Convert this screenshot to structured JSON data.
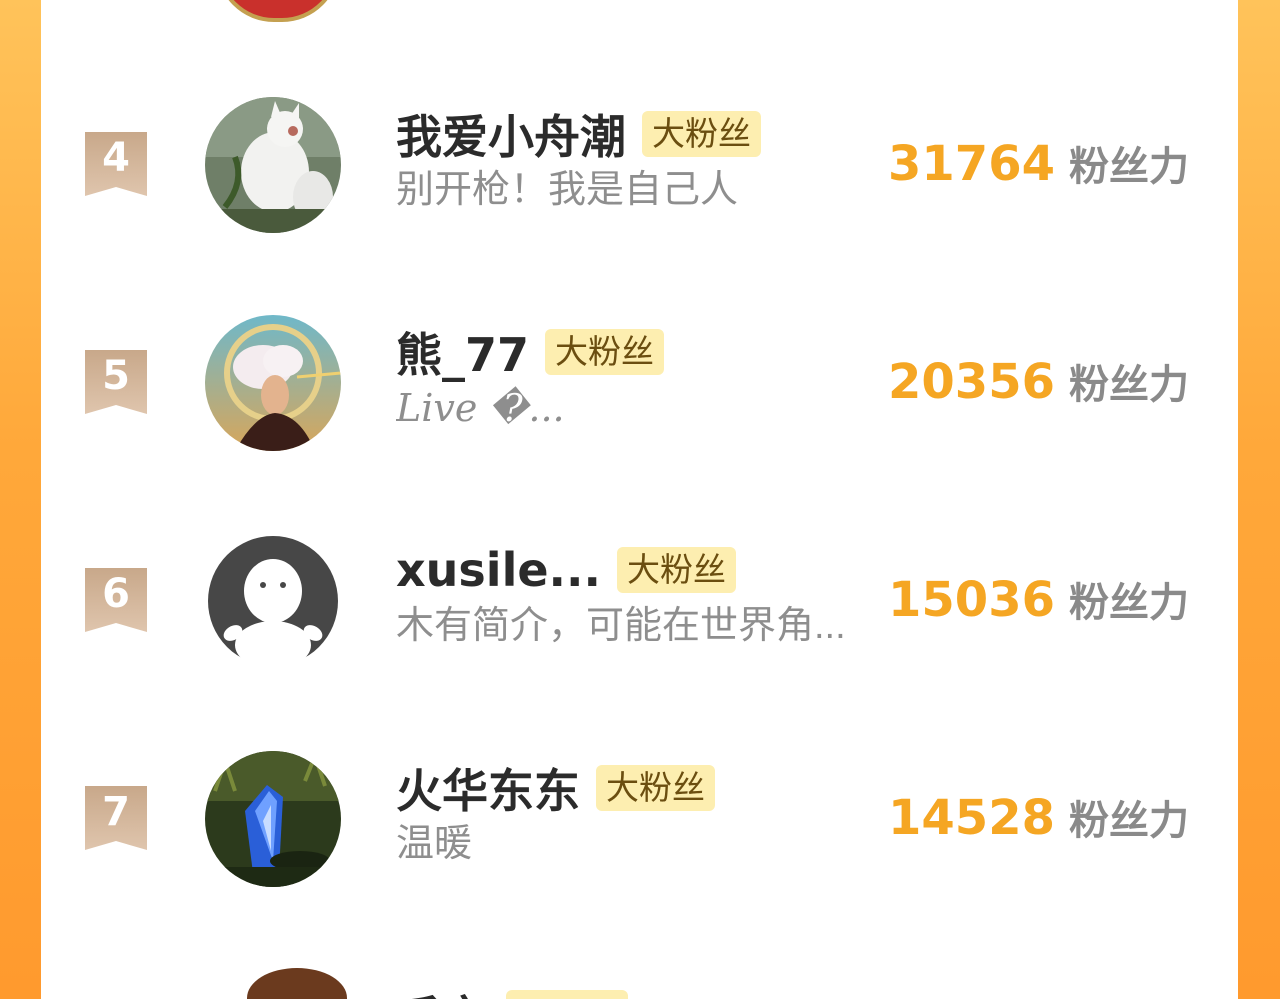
{
  "rows": [
    {
      "rank": "4",
      "name": "我爱小舟潮",
      "badge": "大粉丝",
      "bio": "别开枪！我是自己人",
      "score": "31764",
      "score_label": "粉丝力",
      "avatar_icon": "white-cats-photo"
    },
    {
      "rank": "5",
      "name": "熊_77",
      "badge": "大粉丝",
      "bio": "Live �...",
      "score": "20356",
      "score_label": "粉丝力",
      "avatar_icon": "smoke-portrait-photo"
    },
    {
      "rank": "6",
      "name": "xusile...",
      "badge": "大粉丝",
      "bio": "木有简介，可能在世界角...",
      "score": "15036",
      "score_label": "粉丝力",
      "avatar_icon": "default-user-avatar"
    },
    {
      "rank": "7",
      "name": "火华东东",
      "badge": "大粉丝",
      "bio": "温暖",
      "score": "14528",
      "score_label": "粉丝力",
      "avatar_icon": "blue-crystal-photo"
    }
  ],
  "partial_next": {
    "name": "千亩",
    "badge": "大粉丝"
  },
  "colors": {
    "score": "#f5a623",
    "badge_bg": "#fdeeb0",
    "rank_ribbon": "#c8a88a",
    "frame": "#ffa83a"
  }
}
